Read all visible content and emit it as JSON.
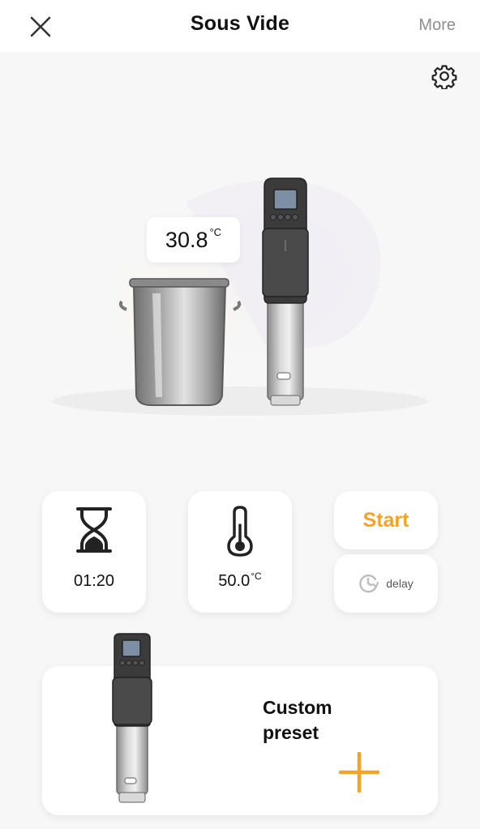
{
  "header": {
    "title": "Sous Vide",
    "more_label": "More",
    "close_icon": "close-icon"
  },
  "settings_icon": "gear-icon",
  "hero": {
    "current_temp_value": "30.8",
    "current_temp_unit": "°C"
  },
  "controls": {
    "timer": {
      "icon": "hourglass-icon",
      "value": "01:20"
    },
    "target_temp": {
      "icon": "thermometer-icon",
      "value": "50.0",
      "unit": "°C"
    },
    "start_label": "Start",
    "delay_label": "delay",
    "delay_icon": "clock-delay-icon"
  },
  "preset": {
    "title_line1": "Custom",
    "title_line2": "preset",
    "add_icon": "plus-icon"
  },
  "colors": {
    "accent": "#f5a327",
    "muted_text": "#8e8e8e",
    "background": "#f7f7f7",
    "card": "#ffffff"
  }
}
